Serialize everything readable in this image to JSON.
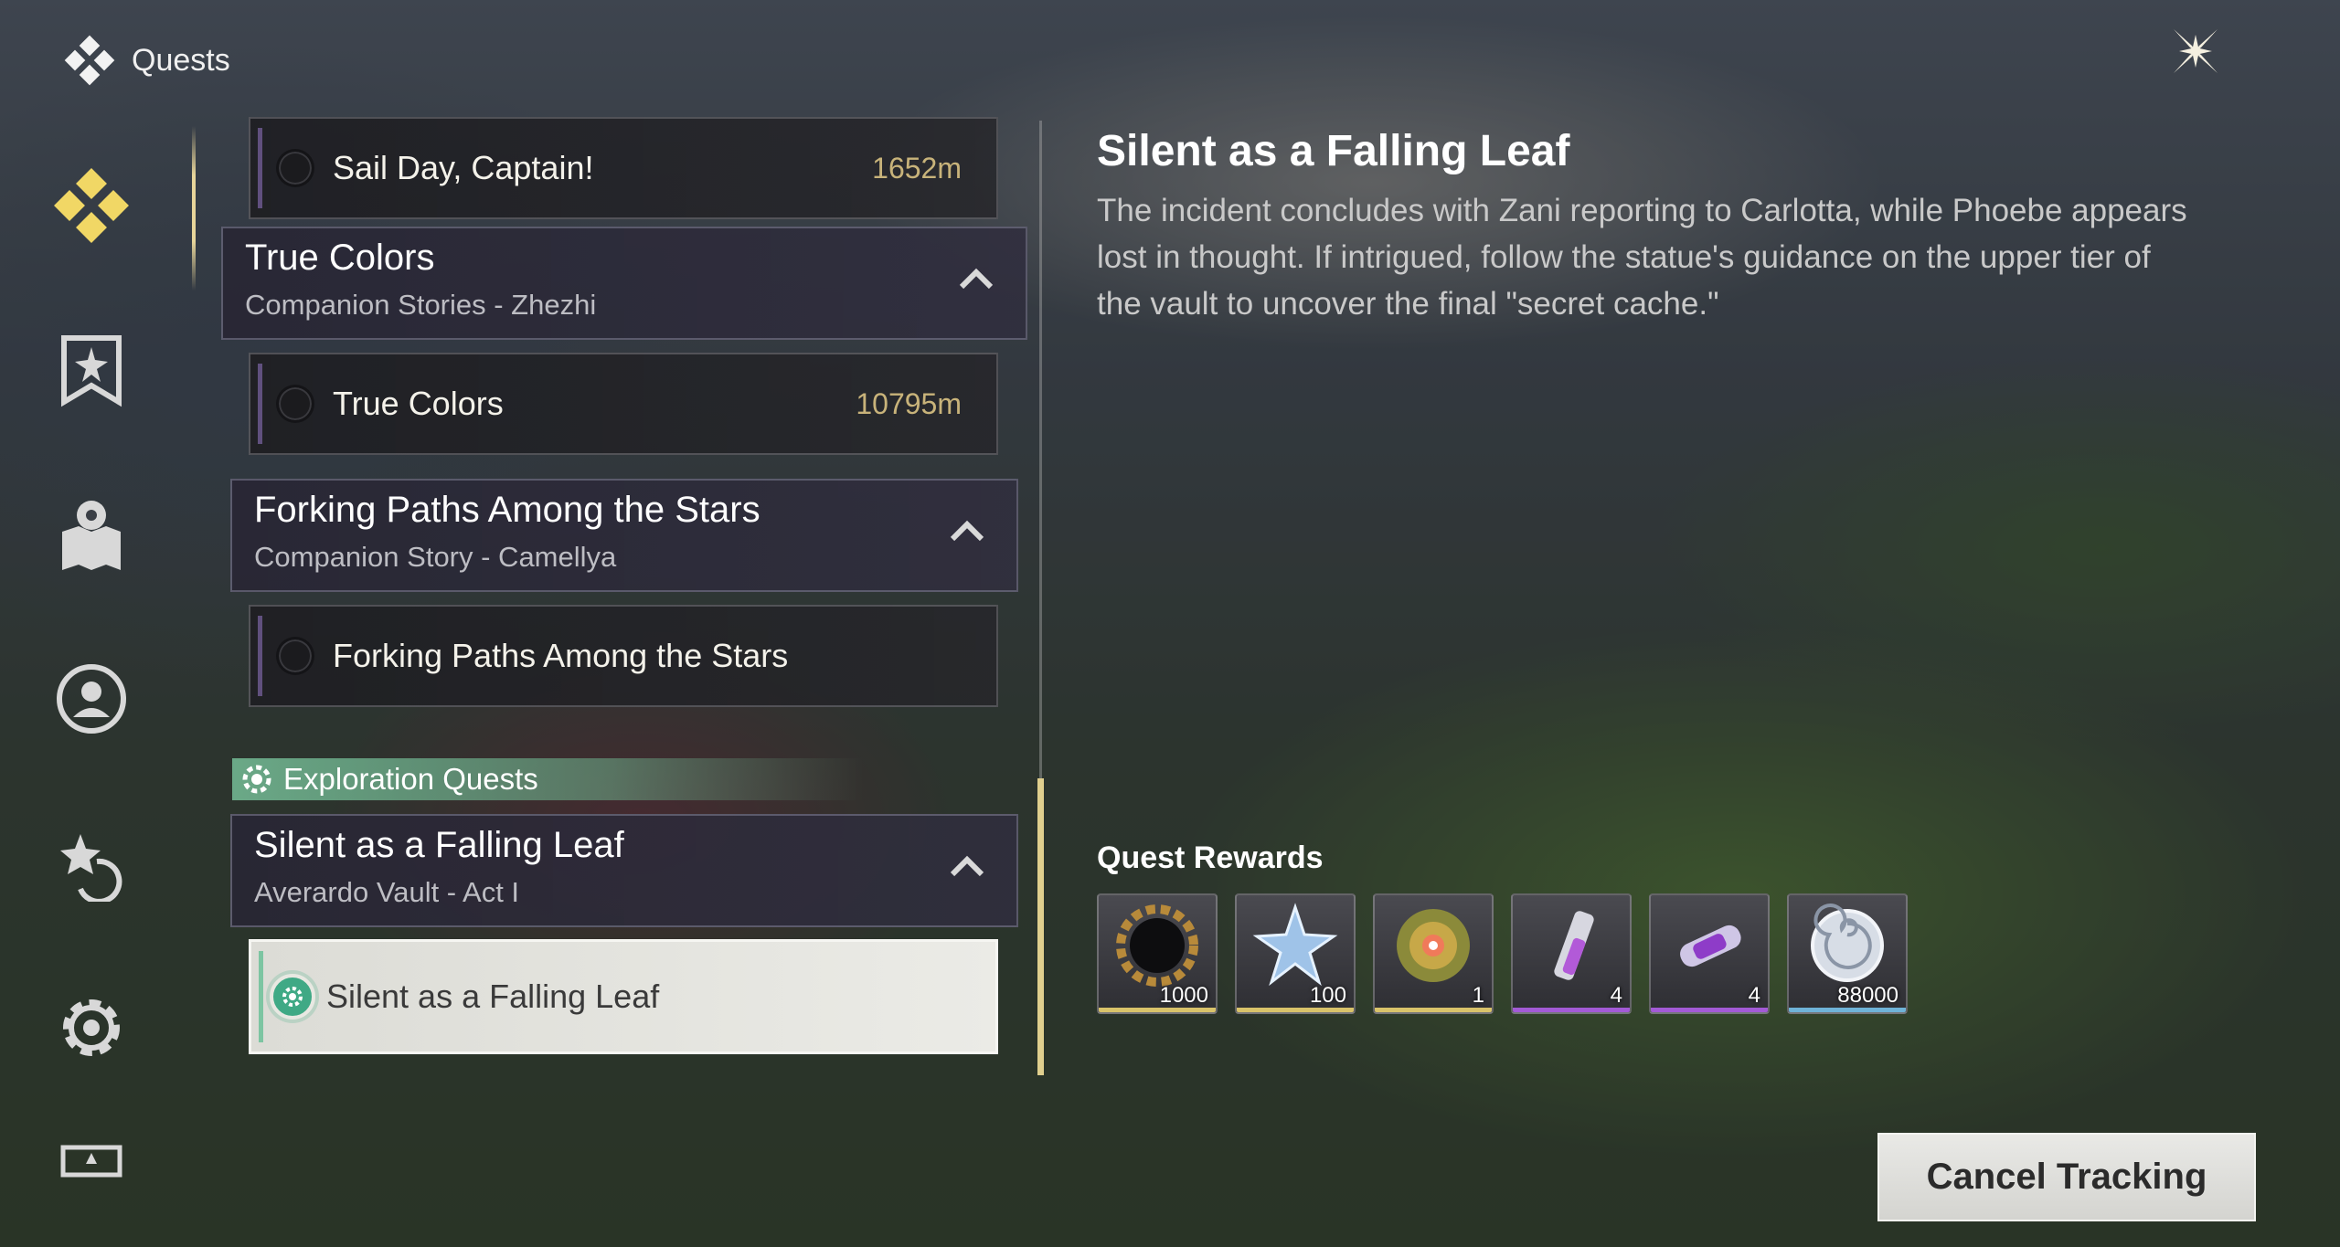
{
  "header": {
    "title": "Quests"
  },
  "nav": {
    "items": [
      {
        "icon": "quest-diamond-icon",
        "active": true
      },
      {
        "icon": "banner-star-icon",
        "active": false
      },
      {
        "icon": "map-pin-icon",
        "active": false
      },
      {
        "icon": "companion-person-icon",
        "active": false
      },
      {
        "icon": "star-refresh-icon",
        "active": false
      },
      {
        "icon": "gear-icon",
        "active": false
      },
      {
        "icon": "screen-icon",
        "active": false
      }
    ]
  },
  "quest_list": {
    "items": [
      {
        "type": "quest",
        "label": "Sail Day, Captain!",
        "distance": "1652m"
      },
      {
        "type": "group",
        "title": "True Colors",
        "subtitle": "Companion Stories - Zhezhi"
      },
      {
        "type": "quest",
        "label": "True Colors",
        "distance": "10795m"
      },
      {
        "type": "group",
        "title": "Forking Paths Among the Stars",
        "subtitle": "Companion Story - Camellya"
      },
      {
        "type": "quest",
        "label": "Forking Paths Among the Stars",
        "distance": ""
      },
      {
        "type": "section",
        "label": "Exploration Quests"
      },
      {
        "type": "group",
        "title": "Silent as a Falling Leaf",
        "subtitle": "Averardo Vault - Act I"
      },
      {
        "type": "quest-active",
        "label": "Silent as a Falling Leaf",
        "distance": ""
      }
    ]
  },
  "detail": {
    "title": "Silent as a Falling Leaf",
    "description": "The incident concludes with Zani reporting to Carlotta, while Phoebe appears lost in thought. If intrigued, follow the statue's guidance on the upper tier of the vault to uncover the final \"secret cache.\""
  },
  "rewards": {
    "title": "Quest Rewards",
    "items": [
      {
        "icon": "dark-gear-coin-icon",
        "qty": "1000",
        "rarity_color": "#d9c36a"
      },
      {
        "icon": "crystal-star-icon",
        "qty": "100",
        "rarity_color": "#d9c36a"
      },
      {
        "icon": "golden-orb-icon",
        "qty": "1",
        "rarity_color": "#d9c36a"
      },
      {
        "icon": "potion-vial-icon",
        "qty": "4",
        "rarity_color": "#a35ad6"
      },
      {
        "icon": "purple-capsule-icon",
        "qty": "4",
        "rarity_color": "#a35ad6"
      },
      {
        "icon": "shell-coin-icon",
        "qty": "88000",
        "rarity_color": "#6fb3d8"
      }
    ]
  },
  "actions": {
    "cancel_tracking": "Cancel Tracking"
  },
  "colors": {
    "accent_gold": "#e0cf8e",
    "exploration_green": "#6eaf8c",
    "distance": "#c8b37a"
  }
}
